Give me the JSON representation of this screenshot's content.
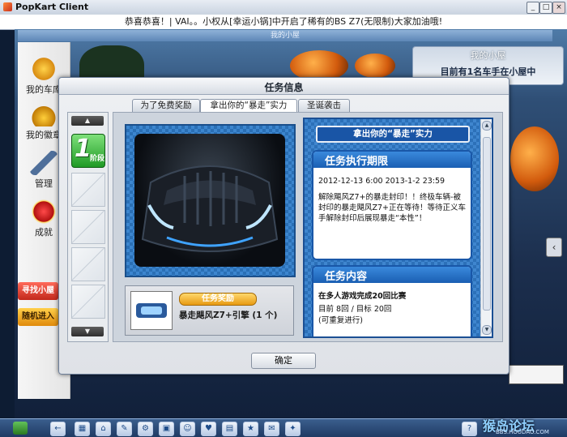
{
  "window": {
    "title": "PopKart Client",
    "controls": [
      "_",
      "□",
      "×"
    ]
  },
  "ticker": {
    "text": "恭喜恭喜！| VAI。。小权从[幸运小锅]中开启了稀有的BS Z7(无限制)大家加油哦!"
  },
  "lobby": {
    "topbar_text": "我的小屋",
    "nav": [
      {
        "label": "我的车库",
        "icon": "garage-icon"
      },
      {
        "label": "我的徽章",
        "icon": "medal-icon"
      },
      {
        "label": "管理",
        "icon": "wrench-icon"
      },
      {
        "label": "成就",
        "icon": "achievement-icon"
      }
    ],
    "buttons": {
      "find_house": "寻找小屋",
      "random_enter": "随机进入"
    },
    "house_panel": {
      "title": "我的小屋",
      "text": "目前有1名车手在小屋中"
    }
  },
  "dialog": {
    "title": "任务信息",
    "tabs": [
      {
        "label": "为了免费奖励",
        "active": false
      },
      {
        "label": "拿出你的“暴走”实力",
        "active": true
      },
      {
        "label": "圣诞袭击",
        "active": false
      }
    ],
    "stages": {
      "active_number": "1",
      "active_label": "阶段",
      "slot_count": 4
    },
    "reward": {
      "tag": "任务奖励",
      "name": "暴走飓风Z7+引擎 (1 个)"
    },
    "mission_banner": "拿出你的“暴走”实力",
    "period": {
      "heading": "任务执行期限",
      "dates": "2012-12-13 6:00   2013-1-2 23:59",
      "description": "解除飓风Z7+的暴走封印！！终极车辆-被封印的暴走飓风Z7+正在等待！等待正义车手解除封印后展现暴走“本性”！"
    },
    "content": {
      "heading": "任务内容",
      "task": "在多人游戏完成20回比赛",
      "progress": "目前 8回 / 目标 20回",
      "repeat": "(可重复进行)"
    },
    "confirm_label": "确定"
  },
  "watermark": {
    "text": "猴岛论坛",
    "sub": "BBS.HOUDAO.COM"
  },
  "colors": {
    "accent_blue": "#1957a8",
    "stage_green": "#1f9a25",
    "reward_gold": "#e79a13"
  }
}
